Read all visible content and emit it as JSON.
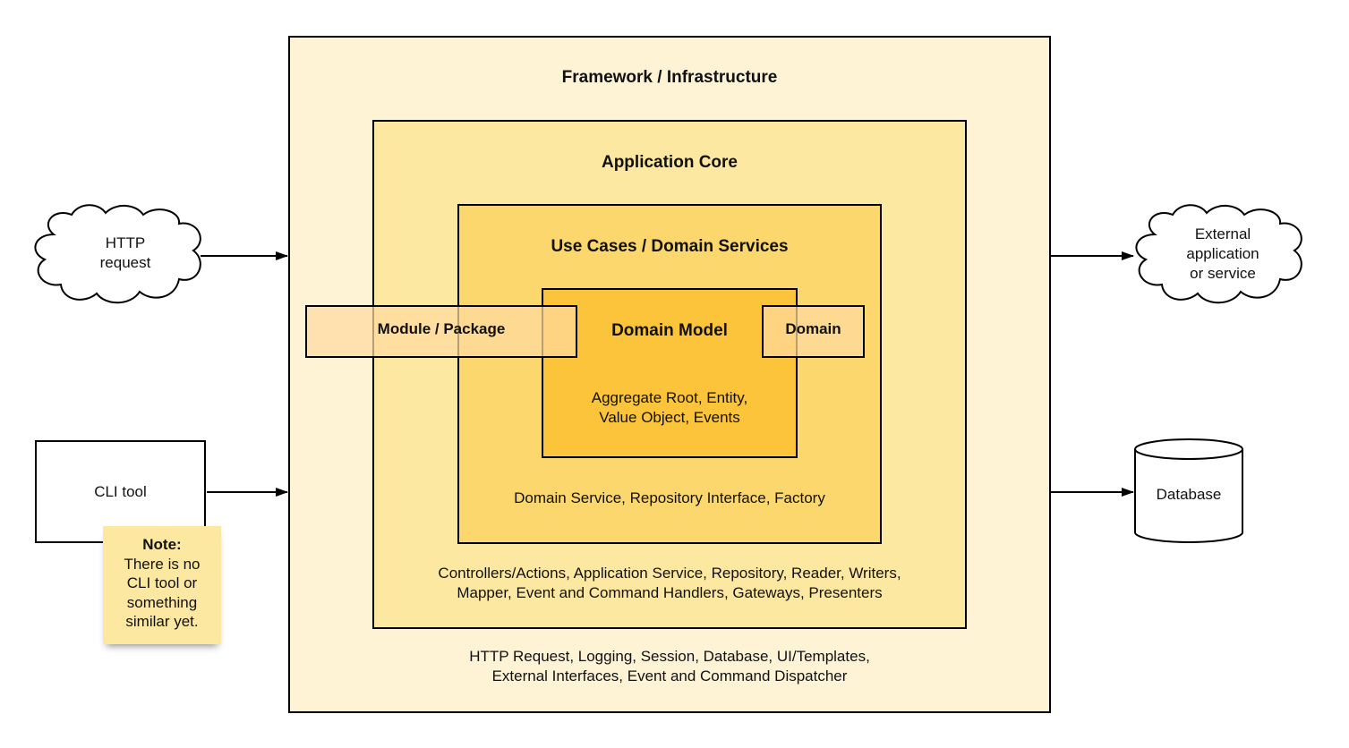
{
  "layers": {
    "framework": {
      "title": "Framework / Infrastructure",
      "description": "HTTP Request, Logging, Session, Database, UI/Templates,\nExternal Interfaces, Event and Command Dispatcher"
    },
    "application_core": {
      "title": "Application Core",
      "description": "Controllers/Actions, Application Service, Repository, Reader, Writers,\nMapper, Event and Command Handlers, Gateways, Presenters"
    },
    "use_cases": {
      "title": "Use Cases / Domain Services",
      "description": "Domain Service, Repository Interface, Factory"
    },
    "domain_model": {
      "title": "Domain Model",
      "description": "Aggregate Root, Entity,\nValue Object, Events"
    }
  },
  "overlays": {
    "module": "Module / Package",
    "domain": "Domain"
  },
  "inputs": {
    "http": "HTTP\nrequest",
    "cli": "CLI tool"
  },
  "outputs": {
    "external": "External\napplication\n  or service",
    "database": "Database"
  },
  "note": {
    "heading": "Note:",
    "body": "There is no\nCLI tool or\nsomething\nsimilar yet."
  },
  "colors": {
    "framework": "#fff3d6",
    "application_core": "#fde8a1",
    "use_cases": "#fcd76d",
    "domain_model": "#fbc43a",
    "overlay": "#ffdaa0",
    "note": "#fde8a1"
  }
}
